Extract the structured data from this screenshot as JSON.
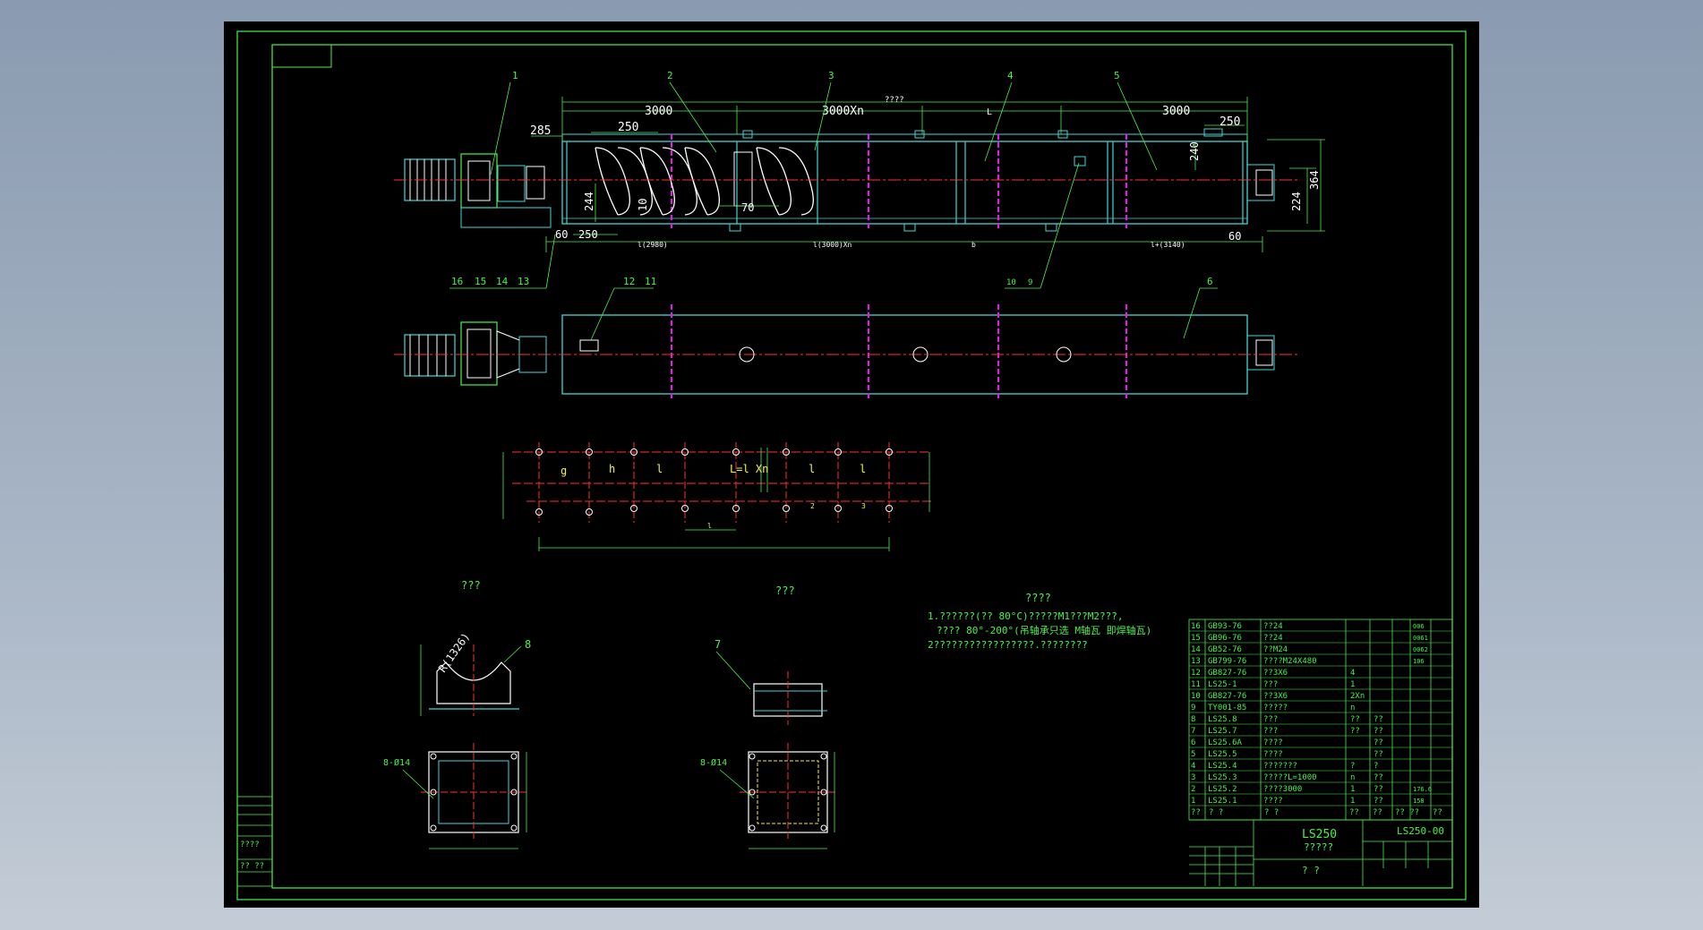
{
  "drawing": {
    "title_main": "LS250",
    "title_sub": "?????",
    "drawing_no": "LS250-00",
    "sign_left": "? ?"
  },
  "colors": {
    "background": "#000000",
    "border": "#49f24b",
    "cyan": "#3fd7d7",
    "red_center": "#ff3030",
    "magenta": "#e020e0",
    "white": "#ffffff",
    "yellow": "#f2f24a"
  },
  "front_view": {
    "top_label": "????",
    "dims_top": [
      "3000",
      "3000Xn",
      "L",
      "3000"
    ],
    "dims_misc": [
      "285",
      "250",
      "250",
      "240",
      "364",
      "224",
      "244",
      "10",
      "70",
      "60",
      "250",
      "60"
    ],
    "dims_bottom": [
      "l(2980)",
      "l(3000)Xn",
      "b",
      "l+(3140)"
    ],
    "balloons_top": [
      "1",
      "2",
      "3",
      "4",
      "5"
    ],
    "balloons_bottom": [
      "16",
      "15",
      "14",
      "13",
      "10",
      "9"
    ]
  },
  "plan_view": {
    "balloons": [
      "12",
      "11",
      "6"
    ]
  },
  "layout_view": {
    "labels": [
      "g",
      "h",
      "l",
      "L=l Xn",
      "l",
      "l"
    ],
    "small": [
      "l",
      "2",
      "3"
    ]
  },
  "details": {
    "left_title": "???",
    "right_title": "???",
    "left_balloon": "8",
    "right_balloon": "7",
    "radius": "R(1326)",
    "holes_left": "8-Ø14",
    "holes_right": "8-Ø14"
  },
  "notes": {
    "heading": "????",
    "line1": "1.??????(??  80°C)?????M1???M2???,",
    "line2": "???? 80°-200°(吊轴承只选 M轴瓦 即焊轴瓦)",
    "line3": "2?????????????????.????????"
  },
  "bom": {
    "rows": [
      {
        "no": "16",
        "code": "GB93-76",
        "name": "??24",
        "qty": "",
        "mat": ""
      },
      {
        "no": "15",
        "code": "GB96-76",
        "name": "??24",
        "qty": "",
        "mat": ""
      },
      {
        "no": "14",
        "code": "GB52-76",
        "name": "??M24",
        "qty": "",
        "mat": ""
      },
      {
        "no": "13",
        "code": "GB799-76",
        "name": "????M24X480",
        "qty": "",
        "mat": ""
      },
      {
        "no": "12",
        "code": "GB827-76",
        "name": "??3X6",
        "qty": "4",
        "mat": ""
      },
      {
        "no": "11",
        "code": "LS25-1",
        "name": "???",
        "qty": "1",
        "mat": ""
      },
      {
        "no": "10",
        "code": "GB827-76",
        "name": "??3X6",
        "qty": "2Xn",
        "mat": ""
      },
      {
        "no": "9",
        "code": "TY001-85",
        "name": "?????",
        "qty": "n",
        "mat": ""
      },
      {
        "no": "8",
        "code": "LS25.8",
        "name": "???",
        "qty": "??",
        "mat": "??"
      },
      {
        "no": "7",
        "code": "LS25.7",
        "name": "???",
        "qty": "??",
        "mat": "??"
      },
      {
        "no": "6",
        "code": "LS25.6A",
        "name": "????",
        "qty": "",
        "mat": "??"
      },
      {
        "no": "5",
        "code": "LS25.5",
        "name": "????",
        "qty": "",
        "mat": "??"
      },
      {
        "no": "4",
        "code": "LS25.4",
        "name": "???????",
        "qty": "?",
        "mat": "?"
      },
      {
        "no": "3",
        "code": "LS25.3",
        "name": "?????L=1000",
        "qty": "n",
        "mat": "??"
      },
      {
        "no": "2",
        "code": "LS25.2",
        "name": "????3000",
        "qty": "1",
        "mat": "??"
      },
      {
        "no": "1",
        "code": "LS25.1",
        "name": "????",
        "qty": "1",
        "mat": "??"
      }
    ],
    "extra_col": [
      "006",
      "0061",
      "0062",
      "106",
      "",
      "",
      "",
      "",
      "",
      "",
      "",
      "",
      "",
      "",
      "176.6",
      "158"
    ],
    "header": [
      "??",
      "?  ?",
      "?    ?",
      "??",
      "??",
      "?? ??",
      "??"
    ]
  },
  "left_strip": {
    "cells": [
      "????",
      "?? ??"
    ]
  }
}
